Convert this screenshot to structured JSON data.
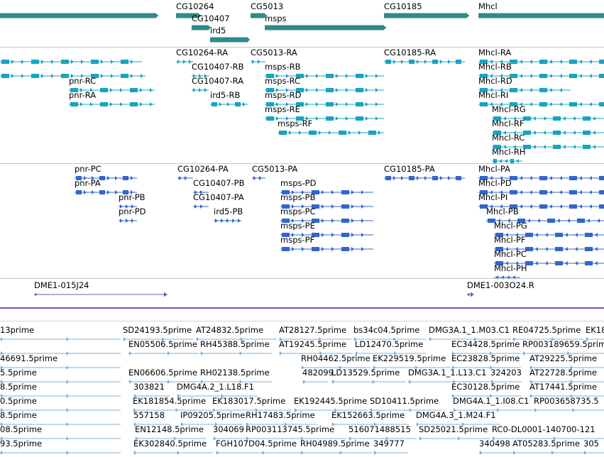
{
  "colors": {
    "gene": "#2f8a8a",
    "transcript": "#19a3c2",
    "protein": "#3366cc",
    "marker": "#7a4fb0",
    "est": "#7fb3dd",
    "separator": "#bfc6cc",
    "axis": "#7a4fb0"
  },
  "tracks": {
    "genes": [
      {
        "label": "",
        "lane": 0,
        "start": 0,
        "end": 220
      },
      {
        "label": "CG10264",
        "lane": 0,
        "start": 248,
        "end": 280
      },
      {
        "label": "CG5013",
        "lane": 0,
        "start": 353,
        "end": 373
      },
      {
        "label": "CG10185",
        "lane": 0,
        "start": 541,
        "end": 658
      },
      {
        "label": "Mhcl",
        "lane": 0,
        "start": 674,
        "end": 851
      },
      {
        "label": "CG10407",
        "lane": 1,
        "start": 270,
        "end": 294
      },
      {
        "label": "msps",
        "lane": 1,
        "start": 373,
        "end": 541
      },
      {
        "label": "ird5",
        "lane": 2,
        "start": 296,
        "end": 349
      }
    ],
    "transcripts": [
      {
        "label": "",
        "lane": 0,
        "start": 0,
        "end": 200
      },
      {
        "label": "CG10264-RA",
        "lane": 0,
        "start": 248,
        "end": 272
      },
      {
        "label": "CG5013-RA",
        "lane": 0,
        "start": 353,
        "end": 374
      },
      {
        "label": "CG10185-RA",
        "lane": 0,
        "start": 541,
        "end": 655
      },
      {
        "label": "Mhcl-RA",
        "lane": 0,
        "start": 674,
        "end": 851
      },
      {
        "label": "",
        "lane": 1,
        "start": 0,
        "end": 205
      },
      {
        "label": "CG10407-RB",
        "lane": 1,
        "start": 270,
        "end": 294
      },
      {
        "label": "msps-RB",
        "lane": 1,
        "start": 373,
        "end": 541
      },
      {
        "label": "Mhcl-RB",
        "lane": 1,
        "start": 674,
        "end": 851
      },
      {
        "label": "pnr-RC",
        "lane": 2,
        "start": 97,
        "end": 218
      },
      {
        "label": "CG10407-RA",
        "lane": 2,
        "start": 270,
        "end": 294
      },
      {
        "label": "msps-RC",
        "lane": 2,
        "start": 373,
        "end": 541
      },
      {
        "label": "Mhcl-RD",
        "lane": 2,
        "start": 674,
        "end": 804
      },
      {
        "label": "pnr-RA",
        "lane": 3,
        "start": 97,
        "end": 218
      },
      {
        "label": "ird5-RB",
        "lane": 3,
        "start": 296,
        "end": 349
      },
      {
        "label": "msps-RD",
        "lane": 3,
        "start": 373,
        "end": 541
      },
      {
        "label": "Mhcl-RI",
        "lane": 3,
        "start": 674,
        "end": 851
      },
      {
        "label": "msps-RE",
        "lane": 4,
        "start": 373,
        "end": 541
      },
      {
        "label": "Mhcl-RG",
        "lane": 4,
        "start": 693,
        "end": 851
      },
      {
        "label": "msps-RF",
        "lane": 5,
        "start": 391,
        "end": 541
      },
      {
        "label": "Mhcl-RF",
        "lane": 5,
        "start": 693,
        "end": 851
      },
      {
        "label": "Mhcl-RC",
        "lane": 6,
        "start": 693,
        "end": 851
      },
      {
        "label": "Mhcl-RH",
        "lane": 7,
        "start": 693,
        "end": 736
      }
    ],
    "proteins": [
      {
        "label": "pnr-PC",
        "lane": 0,
        "start": 105,
        "end": 193
      },
      {
        "label": "CG10264-PA",
        "lane": 0,
        "start": 250,
        "end": 272
      },
      {
        "label": "CG5013-PA",
        "lane": 0,
        "start": 355,
        "end": 374
      },
      {
        "label": "CG10185-PA",
        "lane": 0,
        "start": 541,
        "end": 655
      },
      {
        "label": "Mhcl-PA",
        "lane": 0,
        "start": 674,
        "end": 851
      },
      {
        "label": "pnr-PA",
        "lane": 1,
        "start": 105,
        "end": 193
      },
      {
        "label": "CG10407-PB",
        "lane": 1,
        "start": 272,
        "end": 294
      },
      {
        "label": "msps-PD",
        "lane": 1,
        "start": 395,
        "end": 526
      },
      {
        "label": "Mhcl-PD",
        "lane": 1,
        "start": 674,
        "end": 851
      },
      {
        "label": "pnr-PB",
        "lane": 2,
        "start": 167,
        "end": 193
      },
      {
        "label": "CG10407-PA",
        "lane": 2,
        "start": 272,
        "end": 294
      },
      {
        "label": "msps-PB",
        "lane": 2,
        "start": 395,
        "end": 526
      },
      {
        "label": "Mhcl-PI",
        "lane": 2,
        "start": 674,
        "end": 851
      },
      {
        "label": "pnr-PD",
        "lane": 3,
        "start": 167,
        "end": 193
      },
      {
        "label": "ird5-PB",
        "lane": 3,
        "start": 301,
        "end": 340
      },
      {
        "label": "msps-PC",
        "lane": 3,
        "start": 395,
        "end": 526
      },
      {
        "label": "Mhcl-PB",
        "lane": 3,
        "start": 685,
        "end": 851
      },
      {
        "label": "msps-PE",
        "lane": 4,
        "start": 395,
        "end": 526
      },
      {
        "label": "Mhcl-PG",
        "lane": 4,
        "start": 696,
        "end": 851
      },
      {
        "label": "msps-PF",
        "lane": 5,
        "start": 395,
        "end": 526
      },
      {
        "label": "Mhcl-PF",
        "lane": 5,
        "start": 696,
        "end": 851
      },
      {
        "label": "Mhcl-PC",
        "lane": 6,
        "start": 696,
        "end": 851
      },
      {
        "label": "Mhcl-PH",
        "lane": 7,
        "start": 696,
        "end": 733
      }
    ],
    "markers": [
      {
        "label": "DME1-015J24",
        "lane": 0,
        "start": 48,
        "end": 236
      },
      {
        "label": "DME1-003O24.R",
        "lane": 0,
        "start": 658,
        "end": 668
      }
    ],
    "ests": [
      {
        "label": "13prime",
        "lane": 0,
        "start": 0,
        "end": 170
      },
      {
        "label": "SD24193.5prime",
        "lane": 0,
        "start": 173,
        "end": 273
      },
      {
        "label": "AT24832.5prime",
        "lane": 0,
        "start": 276,
        "end": 390
      },
      {
        "label": "AT28127.5prime",
        "lane": 0,
        "start": 393,
        "end": 495
      },
      {
        "label": "bs34c04.5prime",
        "lane": 0,
        "start": 498,
        "end": 600
      },
      {
        "label": "DMG3A.1_1.M03.C1",
        "lane": 0,
        "start": 604,
        "end": 720
      },
      {
        "label": "RE04725.5prime",
        "lane": 0,
        "start": 722,
        "end": 822
      },
      {
        "label": "EK18",
        "lane": 0,
        "start": 825,
        "end": 851
      },
      {
        "label": "",
        "lane": 1,
        "start": 0,
        "end": 170
      },
      {
        "label": "EN05506.5prime",
        "lane": 1,
        "start": 181,
        "end": 281
      },
      {
        "label": "RH45388.5prime",
        "lane": 1,
        "start": 282,
        "end": 383
      },
      {
        "label": "AT19245.5prime",
        "lane": 1,
        "start": 393,
        "end": 497
      },
      {
        "label": "LD12470.5prime",
        "lane": 1,
        "start": 500,
        "end": 600
      },
      {
        "label": "EC34428.5prime",
        "lane": 1,
        "start": 636,
        "end": 734
      },
      {
        "label": "RP003189659.5prime",
        "lane": 1,
        "start": 736,
        "end": 851
      },
      {
        "label": "46691.5prime",
        "lane": 2,
        "start": 0,
        "end": 170
      },
      {
        "label": "RH04462.5prime",
        "lane": 2,
        "start": 424,
        "end": 522
      },
      {
        "label": "EK229519.5prime",
        "lane": 2,
        "start": 525,
        "end": 634
      },
      {
        "label": "EC23828.5prime",
        "lane": 2,
        "start": 636,
        "end": 734
      },
      {
        "label": "AT29225.5prime",
        "lane": 2,
        "start": 746,
        "end": 851
      },
      {
        "label": "5.5prime",
        "lane": 3,
        "start": 0,
        "end": 170
      },
      {
        "label": "EN06606.5prime",
        "lane": 3,
        "start": 181,
        "end": 281
      },
      {
        "label": "RH02138.5prime",
        "lane": 3,
        "start": 282,
        "end": 383
      },
      {
        "label": "482099",
        "lane": 3,
        "start": 426,
        "end": 462
      },
      {
        "label": "LD13529.5prime",
        "lane": 3,
        "start": 467,
        "end": 572
      },
      {
        "label": "DMG3A.1_1.L13.C1",
        "lane": 3,
        "start": 575,
        "end": 690
      },
      {
        "label": "324203",
        "lane": 3,
        "start": 691,
        "end": 735
      },
      {
        "label": "AT22728.5prime",
        "lane": 3,
        "start": 746,
        "end": 851
      },
      {
        "label": "8.5prime",
        "lane": 4,
        "start": 0,
        "end": 170
      },
      {
        "label": "303821",
        "lane": 4,
        "start": 188,
        "end": 240
      },
      {
        "label": "DMG4A.2_1.L18.F1",
        "lane": 4,
        "start": 249,
        "end": 363
      },
      {
        "label": "EC30128.5prime",
        "lane": 4,
        "start": 636,
        "end": 734
      },
      {
        "label": "AT17441.5prime",
        "lane": 4,
        "start": 746,
        "end": 851
      },
      {
        "label": "0.5prime",
        "lane": 5,
        "start": 0,
        "end": 170
      },
      {
        "label": "EK181854.5prime",
        "lane": 5,
        "start": 187,
        "end": 297
      },
      {
        "label": "EK183017.5prime",
        "lane": 5,
        "start": 299,
        "end": 410
      },
      {
        "label": "EK192445.5prime",
        "lane": 5,
        "start": 414,
        "end": 518
      },
      {
        "label": "SD10411.5prime",
        "lane": 5,
        "start": 521,
        "end": 622
      },
      {
        "label": "DMG4A.1_1.I08.C1",
        "lane": 5,
        "start": 638,
        "end": 751
      },
      {
        "label": "RP003658735.5",
        "lane": 5,
        "start": 752,
        "end": 851
      },
      {
        "label": "8.5prime",
        "lane": 6,
        "start": 0,
        "end": 170
      },
      {
        "label": "557158",
        "lane": 6,
        "start": 188,
        "end": 240
      },
      {
        "label": "IP09205.5prime",
        "lane": 6,
        "start": 254,
        "end": 343
      },
      {
        "label": "RH17483.5prime",
        "lane": 6,
        "start": 346,
        "end": 446
      },
      {
        "label": "EK152663.5prime",
        "lane": 6,
        "start": 467,
        "end": 576
      },
      {
        "label": "DMG4A.3_1.M24.F1",
        "lane": 6,
        "start": 586,
        "end": 705
      },
      {
        "label": "08.5prime",
        "lane": 7,
        "start": 0,
        "end": 170
      },
      {
        "label": "EN12148.5prime",
        "lane": 7,
        "start": 190,
        "end": 290
      },
      {
        "label": "304069",
        "lane": 7,
        "start": 300,
        "end": 345
      },
      {
        "label": "RP003113745.5prime",
        "lane": 7,
        "start": 346,
        "end": 488
      },
      {
        "label": "516071488515",
        "lane": 7,
        "start": 491,
        "end": 587
      },
      {
        "label": "SD25021.5prime",
        "lane": 7,
        "start": 590,
        "end": 690
      },
      {
        "label": "RC0-DL0001-140700-121",
        "lane": 7,
        "start": 693,
        "end": 851
      },
      {
        "label": "93.5prime",
        "lane": 8,
        "start": 0,
        "end": 170
      },
      {
        "label": "EK302840.5prime",
        "lane": 8,
        "start": 188,
        "end": 300
      },
      {
        "label": "FGH107D04.5prime",
        "lane": 8,
        "start": 304,
        "end": 423
      },
      {
        "label": "RH04989.5prime",
        "lane": 8,
        "start": 423,
        "end": 524
      },
      {
        "label": "349777",
        "lane": 8,
        "start": 526,
        "end": 575
      },
      {
        "label": "340498",
        "lane": 8,
        "start": 675,
        "end": 722
      },
      {
        "label": "AT05283.5prime",
        "lane": 8,
        "start": 722,
        "end": 822
      },
      {
        "label": "305",
        "lane": 8,
        "start": 822,
        "end": 851
      }
    ]
  }
}
